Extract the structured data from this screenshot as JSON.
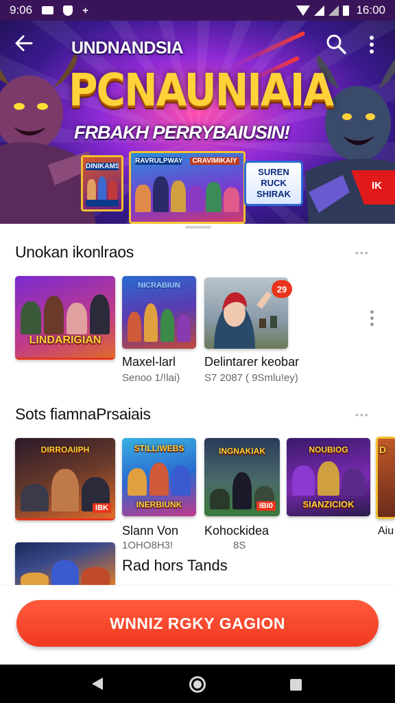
{
  "status_bar": {
    "time": "9:06",
    "clock": "16:00",
    "icons": [
      "notification-box-icon",
      "shield-icon",
      "plus-icon",
      "wifi-icon",
      "signal-icon",
      "signal-icon",
      "battery-icon"
    ]
  },
  "hero": {
    "top_text": "UNDNANDSIA",
    "title": "PCNAUNIAIA",
    "subtitle": "FRBAKH PERRYBAIUSIN!",
    "card1_label": "DINIKAMS",
    "card2_label": "RAVRULPWAYS",
    "card2_label_b": "CRAVIMIKAIY",
    "badge_lines": [
      "SUREN",
      "RUCK",
      "SHIRAK"
    ],
    "red_tag": "IK"
  },
  "section1": {
    "title": "Unokan ikonlraos",
    "items": [
      {
        "label": "LINDARIGIAN",
        "title": "",
        "meta": ""
      },
      {
        "label": "NICRABIUN",
        "title": "Maxel-larl",
        "meta": "Senoo 1/!lai)"
      },
      {
        "label": "",
        "title": "Delintarer keobar",
        "meta": "S7 2087 ( 9Smlu!ey)",
        "badge": "29"
      }
    ]
  },
  "section2": {
    "title": "Sots fiamnaPrsaiais",
    "items": [
      {
        "label": "DIRROAIIPH",
        "title": "",
        "meta": "",
        "corner": "IBK"
      },
      {
        "label": "STILLIWEBS",
        "label_b": "INERBIUNK",
        "title": "Slann Von",
        "meta": "1OHO8H3!"
      },
      {
        "label": "INGNAKIAK",
        "title": "Kohockidea",
        "meta": "8S",
        "corner": "IBI0"
      },
      {
        "label": "NOUBIOG",
        "label_b": "SIANZICIOK",
        "title": "",
        "meta": ""
      },
      {
        "label": "D",
        "title": "Aiu",
        "meta": ""
      }
    ],
    "extra_title": "Rad hors Tands"
  },
  "cta": {
    "label": "WNNIZ RGKY GAGION"
  },
  "colors": {
    "accent": "#f03a22",
    "status_bar": "#3a1458",
    "title_gold": "#ffd23a"
  }
}
